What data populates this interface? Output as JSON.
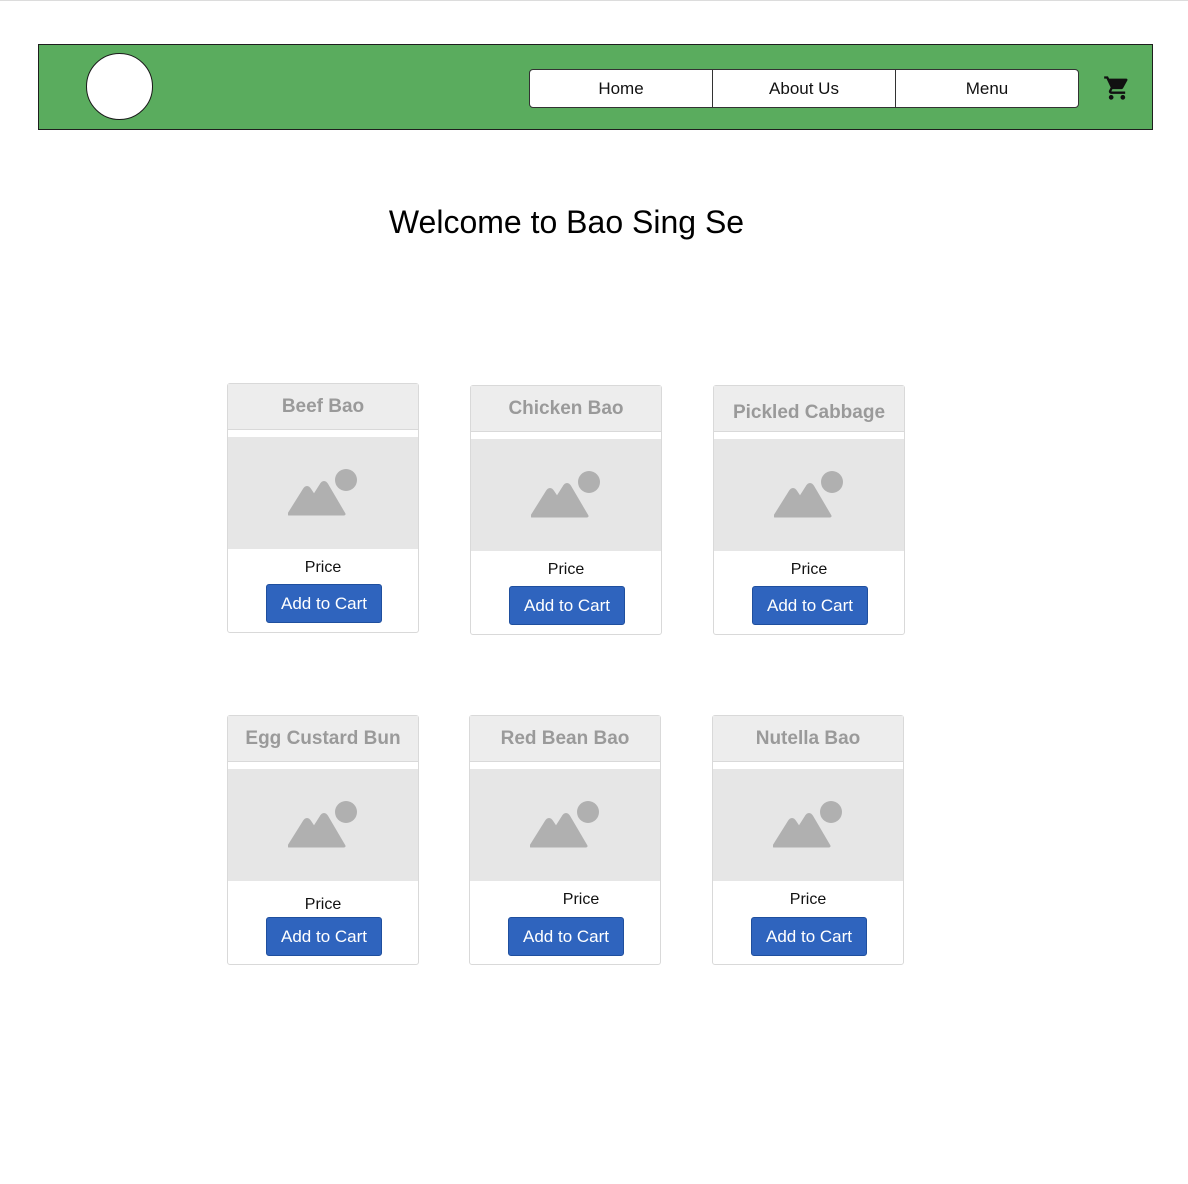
{
  "header": {
    "nav": [
      "Home",
      "About Us",
      "Menu"
    ]
  },
  "main": {
    "title": "Welcome to Bao Sing Se"
  },
  "products": [
    {
      "name": "Beef Bao",
      "price_label": "Price",
      "button_label": "Add to Cart"
    },
    {
      "name": "Chicken Bao",
      "price_label": "Price",
      "button_label": "Add to Cart"
    },
    {
      "name": "Pickled Cabbage",
      "price_label": "Price",
      "button_label": "Add to Cart"
    },
    {
      "name": "Egg Custard Bun",
      "price_label": "Price",
      "button_label": "Add to Cart"
    },
    {
      "name": "Red Bean Bao",
      "price_label": "Price",
      "button_label": "Add to Cart"
    },
    {
      "name": "Nutella Bao",
      "price_label": "Price",
      "button_label": "Add to Cart"
    }
  ],
  "colors": {
    "header_bg": "#5aac5e",
    "button_bg": "#2f64be",
    "card_title_text": "#9a9a9a"
  },
  "icons": {
    "cart": "shopping-cart-icon",
    "image_placeholder": "image-placeholder-icon"
  }
}
